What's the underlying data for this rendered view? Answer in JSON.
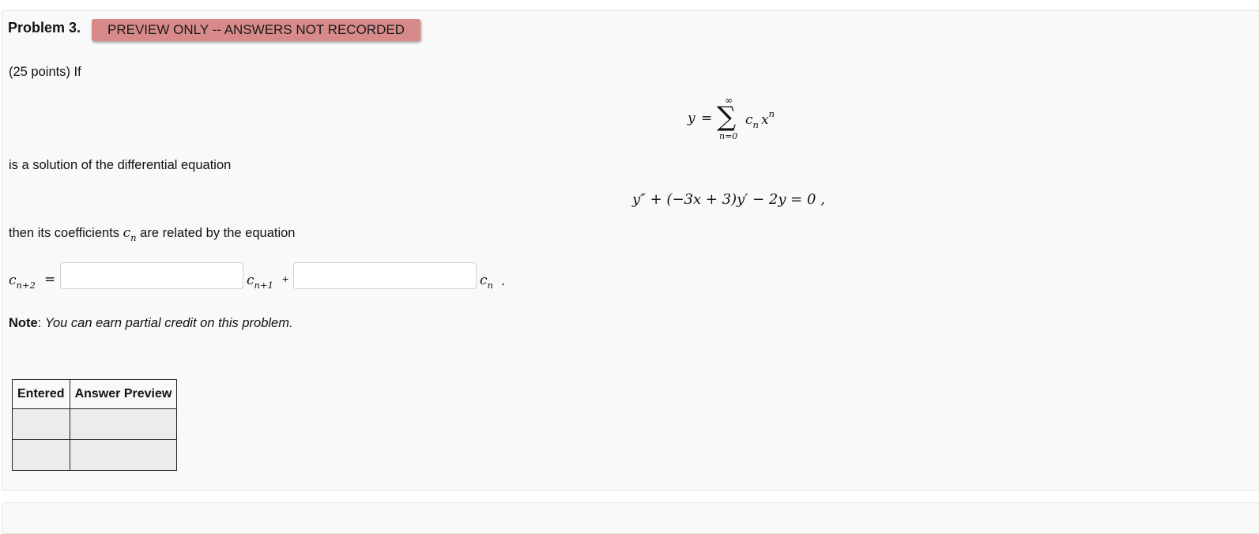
{
  "problem": {
    "title": "Problem 3.",
    "preview_badge": "PREVIEW ONLY -- ANSWERS NOT RECORDED",
    "points_text": "(25 points) If",
    "series_eq": {
      "y": "y",
      "eq": "=",
      "sum": "∑",
      "upper": "∞",
      "lower": "n=0",
      "c": "c",
      "c_sub": "n",
      "x": "x",
      "x_sup": "n"
    },
    "solution_text": "is a solution of the differential equation",
    "diff_eq": "y″ + (−3x + 3)y′ − 2y = 0 ,",
    "coeff_text_before": "then its coefficients",
    "coeff_symbol": "c",
    "coeff_symbol_sub": "n",
    "coeff_text_after": "are related by the equation",
    "recurrence": {
      "lhs": "c",
      "lhs_sub": "n+2",
      "eq": "=",
      "term1": "c",
      "term1_sub": "n+1",
      "plus": "+",
      "term2": "c",
      "term2_sub": "n",
      "end": "."
    },
    "inputs": [
      {
        "value": "",
        "placeholder": ""
      },
      {
        "value": "",
        "placeholder": ""
      }
    ],
    "note_label": "Note",
    "note_colon": ":",
    "note_text": "You can earn partial credit on this problem."
  },
  "results_table": {
    "headers": [
      "Entered",
      "Answer Preview"
    ],
    "rows": [
      [
        "",
        ""
      ],
      [
        "",
        ""
      ]
    ]
  },
  "colors": {
    "badge_bg": "#d88a8a",
    "panel_bg": "#f9f9f9",
    "cell_bg": "#ececec"
  }
}
